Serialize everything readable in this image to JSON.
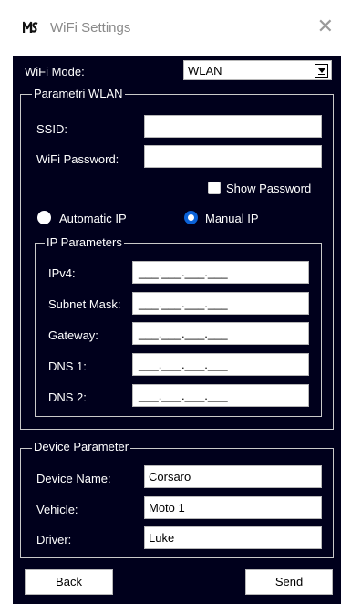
{
  "window": {
    "title": "WiFi Settings",
    "close_icon": "close-icon",
    "logo_icon": "app-logo-icon"
  },
  "wifi_mode": {
    "label": "WiFi Mode:",
    "selected": "WLAN"
  },
  "wlan_group": {
    "legend": "Parametri WLAN",
    "ssid_label": "SSID:",
    "ssid_value": "",
    "password_label": "WiFi Password:",
    "password_value": "",
    "show_password": {
      "label": "Show Password",
      "checked": false
    },
    "automatic_ip": {
      "label": "Automatic IP",
      "checked": false
    },
    "manual_ip": {
      "label": "Manual IP",
      "checked": true
    }
  },
  "ip_group": {
    "legend": "IP Parameters",
    "fields": [
      {
        "label": "IPv4:",
        "value": "___.___.___.___"
      },
      {
        "label": "Subnet Mask:",
        "value": "___.___.___.___"
      },
      {
        "label": "Gateway:",
        "value": "___.___.___.___"
      },
      {
        "label": "DNS 1:",
        "value": "___.___.___.___"
      },
      {
        "label": "DNS 2:",
        "value": "___.___.___.___"
      }
    ]
  },
  "device_group": {
    "legend": "Device Parameter",
    "device_name_label": "Device Name:",
    "device_name_value": "Corsaro",
    "vehicle_label": "Vehicle:",
    "vehicle_value": "Moto 1",
    "driver_label": "Driver:",
    "driver_value": "Luke"
  },
  "buttons": {
    "back": "Back",
    "send": "Send"
  },
  "colors": {
    "client_bg": "#00001c",
    "radio_accent": "#0b62d8"
  }
}
